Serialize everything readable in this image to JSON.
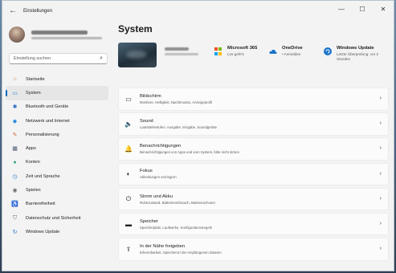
{
  "window": {
    "title": "Einstellungen",
    "back": "←",
    "minimize": "—",
    "maximize": "☐",
    "close": "✕"
  },
  "sidebar": {
    "search_placeholder": "Einstellung suchen",
    "items": [
      {
        "label": "Startseite",
        "icon": "home-icon",
        "glyph": "⌂",
        "color": "#d4812a"
      },
      {
        "label": "System",
        "icon": "monitor-icon",
        "glyph": "▭",
        "color": "#2b84d6"
      },
      {
        "label": "Bluetooth und Geräte",
        "icon": "bluetooth-icon",
        "glyph": "✱",
        "color": "#2a6fc9"
      },
      {
        "label": "Netzwerk und Internet",
        "icon": "wifi-icon",
        "glyph": "◆",
        "color": "#2b8be0"
      },
      {
        "label": "Personalisierung",
        "icon": "brush-icon",
        "glyph": "✎",
        "color": "#d06a2c"
      },
      {
        "label": "Apps",
        "icon": "apps-icon",
        "glyph": "▦",
        "color": "#4a5a6e"
      },
      {
        "label": "Konten",
        "icon": "account-icon",
        "glyph": "●",
        "color": "#2ea37a"
      },
      {
        "label": "Zeit und Sprache",
        "icon": "globe-clock-icon",
        "glyph": "◷",
        "color": "#2a78c8"
      },
      {
        "label": "Spielen",
        "icon": "gamepad-icon",
        "glyph": "◉",
        "color": "#6a6a6a"
      },
      {
        "label": "Barrierefreiheit",
        "icon": "accessibility-icon",
        "glyph": "♿",
        "color": "#2a6fc9"
      },
      {
        "label": "Datenschutz und Sicherheit",
        "icon": "shield-icon",
        "glyph": "⛉",
        "color": "#6a6a72"
      },
      {
        "label": "Windows Update",
        "icon": "update-icon",
        "glyph": "↻",
        "color": "#1f73c8"
      }
    ]
  },
  "main": {
    "title": "System",
    "quick": {
      "m365": {
        "title": "Microsoft 365",
        "sub": "Los geht's",
        "colors": [
          "#f25022",
          "#7fba00",
          "#00a4ef",
          "#ffb900"
        ]
      },
      "onedrive": {
        "title": "OneDrive",
        "sub": "• Anmelden",
        "icon": "cloud-icon",
        "color": "#1b74c9"
      },
      "update": {
        "title": "Windows Update",
        "sub1": "Letzte Überprüfung: vor 2",
        "sub2": "Stunden",
        "icon": "update-icon",
        "color": "#1b74c9"
      }
    },
    "cards": [
      {
        "title": "Bildschirm",
        "sub": "Monitore, Helligkeit, Nachtmodus, Anzeigeprofil",
        "icon": "display-icon",
        "glyph": "▭"
      },
      {
        "title": "Sound",
        "sub": "Lautstärkestufen, Ausgabe, Eingabe, Soundgeräte",
        "icon": "speaker-icon",
        "glyph": "🔈"
      },
      {
        "title": "Benachrichtigungen",
        "sub": "Benachrichtigungen von Apps und vom System, bitte nicht stören",
        "icon": "bell-icon",
        "glyph": "🔔"
      },
      {
        "title": "Fokus",
        "sub": "Ablenkungen verringern",
        "icon": "focus-icon",
        "glyph": "◐"
      },
      {
        "title": "Strom und Akku",
        "sub": "Ruhezustand, Batterieverbrauch, Batterieschoner",
        "icon": "power-icon",
        "glyph": "⏻"
      },
      {
        "title": "Speicher",
        "sub": "Speicherplatz, Laufwerke, Konfigurationsregeln",
        "icon": "storage-icon",
        "glyph": "▬"
      },
      {
        "title": "In der Nähe freigeben",
        "sub": "Erkennbarkeit, Speicherort der empfangenen Dateien",
        "icon": "share-icon",
        "glyph": "⇪"
      }
    ],
    "chevron": "›"
  }
}
